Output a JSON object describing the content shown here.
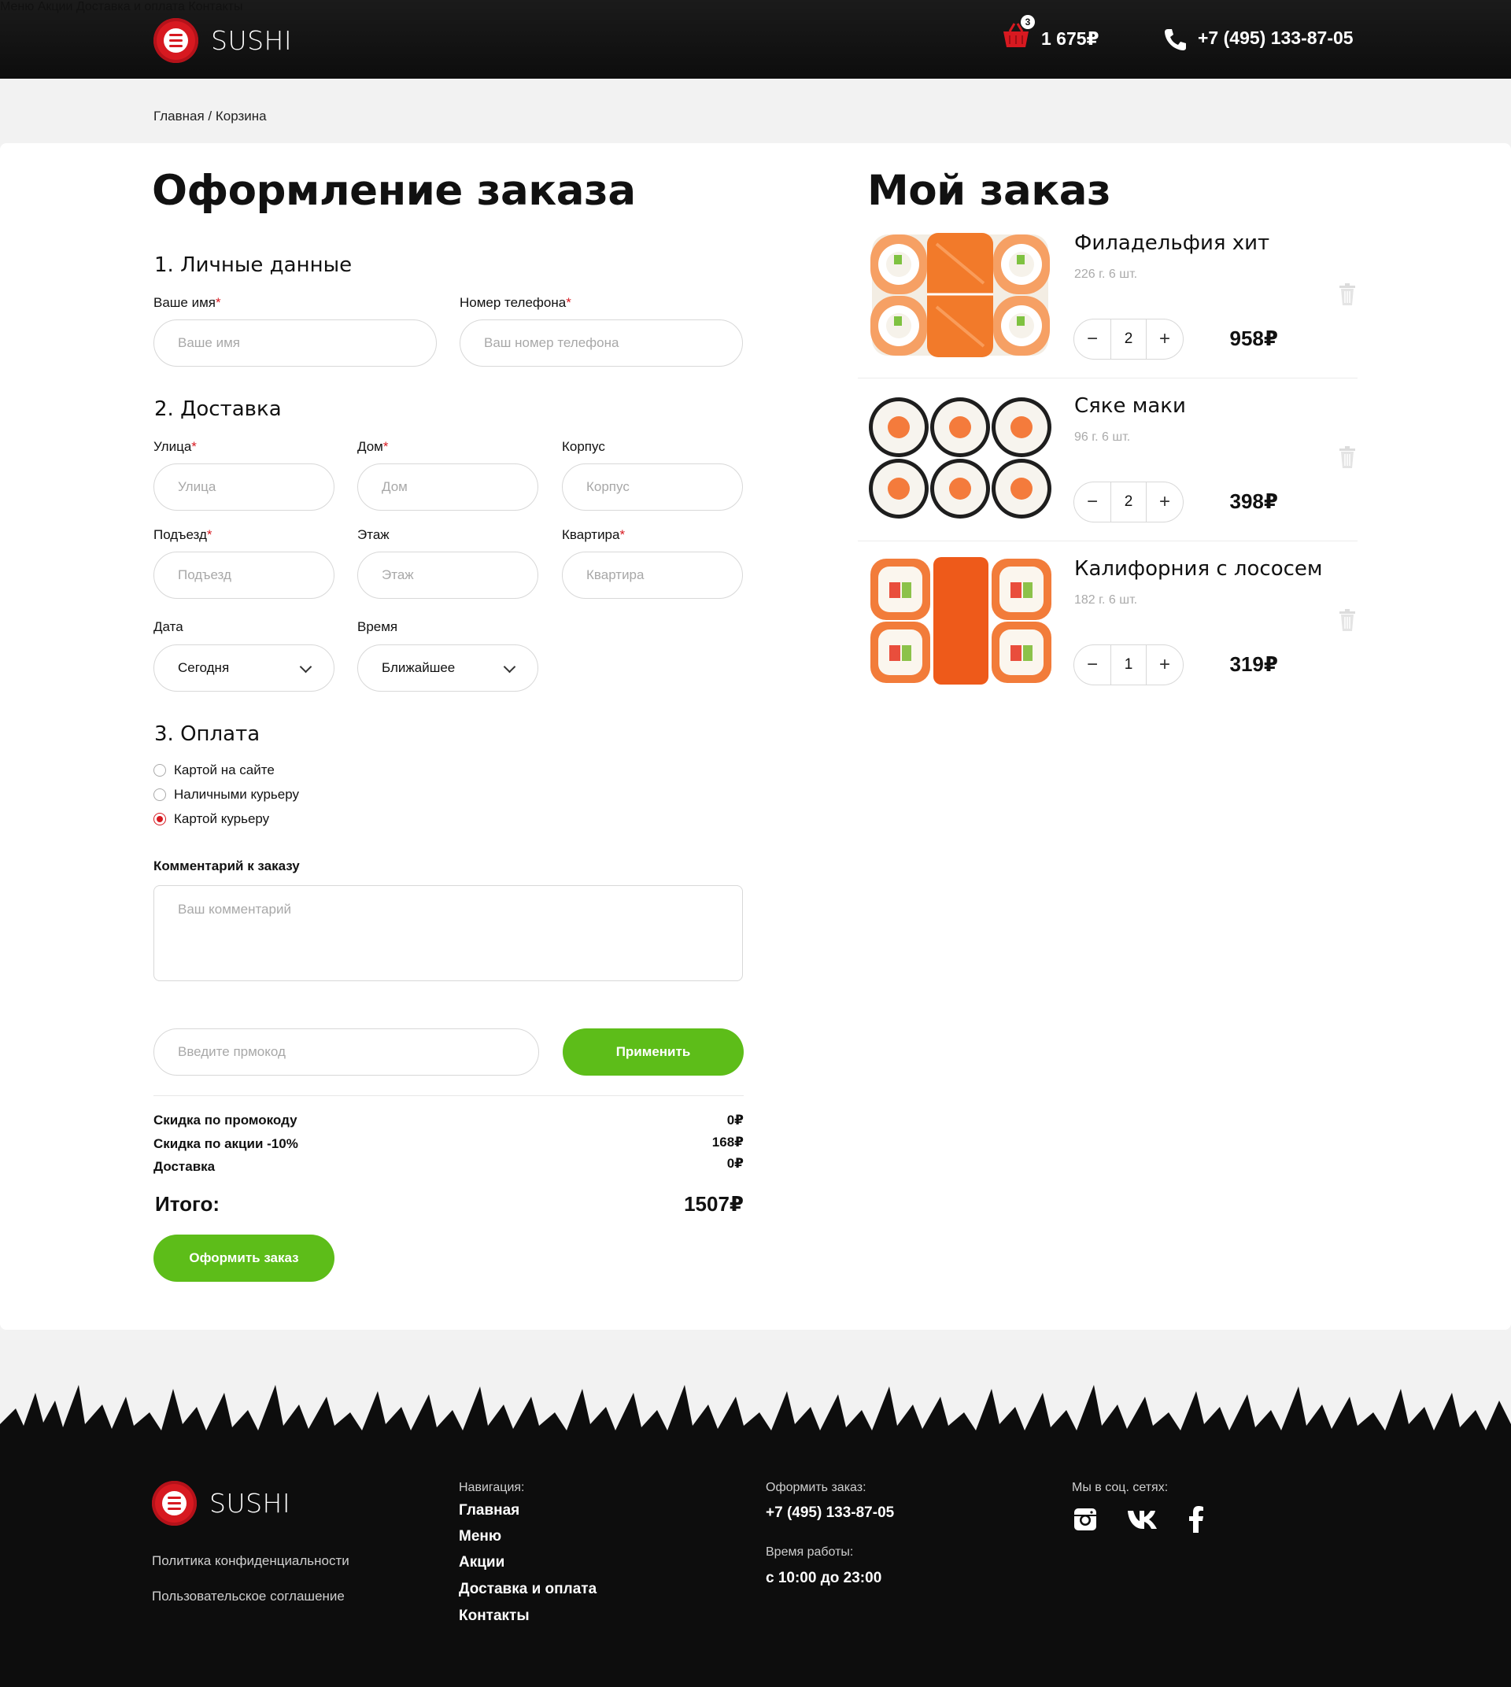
{
  "header": {
    "logo_text": "SUSHI",
    "nav": [
      "Меню",
      "Акции",
      "Доставка и оплата",
      "Контакты"
    ],
    "cart_count": "3",
    "cart_total": "1 675₽",
    "phone": "+7 (495) 133-87-05"
  },
  "breadcrumb": "Главная / Корзина",
  "checkout": {
    "title": "Оформление заказа",
    "section1": "1. Личные данные",
    "name_label": "Ваше имя",
    "name_placeholder": "Ваше имя",
    "phone_label": "Номер телефона",
    "phone_placeholder": "Ваш номер телефона",
    "section2": "2. Доставка",
    "street_label": "Улица",
    "street_placeholder": "Улица",
    "house_label": "Дом",
    "house_placeholder": "Дом",
    "building_label": "Корпус",
    "building_placeholder": "Корпус",
    "entrance_label": "Подъезд",
    "entrance_placeholder": "Подъезд",
    "floor_label": "Этаж",
    "floor_placeholder": "Этаж",
    "apartment_label": "Квартира",
    "apartment_placeholder": "Квартира",
    "date_label": "Дата",
    "date_value": "Сегодня",
    "time_label": "Время",
    "time_value": "Ближайшее",
    "section3": "3. Оплата",
    "payment_options": [
      "Картой на сайте",
      "Наличными курьеру",
      "Картой курьеру"
    ],
    "payment_selected": 2,
    "comment_label": "Комментарий к заказу",
    "comment_placeholder": "Ваш комментарий",
    "promo_placeholder": "Введите прмокод",
    "apply_label": "Применить",
    "promo_discount_label": "Скидка по промокоду",
    "promo_discount_value": "0₽",
    "sale_discount_label": "Скидка по акции -10%",
    "sale_discount_value": "168₽",
    "delivery_label": "Доставка",
    "delivery_value": "0₽",
    "total_label": "Итого:",
    "total_value": "1507₽",
    "submit_label": "Оформить заказ"
  },
  "order": {
    "title": "Мой заказ",
    "items": [
      {
        "name": "Филадельфия хит",
        "meta": "226 г. 6 шт.",
        "qty": "2",
        "price": "958₽"
      },
      {
        "name": "Сяке маки",
        "meta": "96 г. 6 шт.",
        "qty": "2",
        "price": "398₽"
      },
      {
        "name": "Калифорния с лососем",
        "meta": "182 г. 6 шт.",
        "qty": "1",
        "price": "319₽"
      }
    ]
  },
  "footer": {
    "logo_text": "SUSHI",
    "privacy": "Политика конфиденциальности",
    "agreement": "Пользовательское соглашение",
    "nav_title": "Навигация:",
    "nav": [
      "Главная",
      "Меню",
      "Акции",
      "Доставка и оплата",
      "Контакты"
    ],
    "order_title": "Оформить заказ:",
    "order_phone": "+7 (495) 133-87-05",
    "hours_title": "Время работы:",
    "hours": "с 10:00 до 23:00",
    "social_title": "Мы в соц. сетях:"
  },
  "colors": {
    "accent_red": "#d71920",
    "green": "#5dbd19",
    "dark": "#0d0d0d"
  }
}
